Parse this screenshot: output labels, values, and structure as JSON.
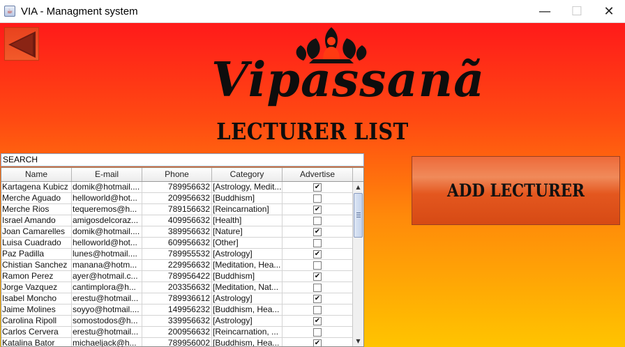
{
  "window": {
    "title": "VIA - Managment system",
    "minimize": "—",
    "maximize": "☐",
    "close": "✕"
  },
  "logo": {
    "text": "Vipassanã"
  },
  "page": {
    "title": "LECTURER LIST"
  },
  "search": {
    "value": "SEARCH"
  },
  "table": {
    "headers": [
      "Name",
      "E-mail",
      "Phone",
      "Category",
      "Advertise"
    ],
    "rows": [
      {
        "name": "Kartagena Kubicz",
        "email": "domik@hotmail....",
        "phone": "789956632",
        "category": "[Astrology, Medit...",
        "advertise": true
      },
      {
        "name": "Merche Aguado",
        "email": "helloworld@hot...",
        "phone": "209956632",
        "category": "[Buddhism]",
        "advertise": false
      },
      {
        "name": "Merche Rios",
        "email": "tequeremos@h...",
        "phone": "789156632",
        "category": "[Reincarnation]",
        "advertise": true
      },
      {
        "name": "Israel Amando",
        "email": "amigosdelcoraz...",
        "phone": "409956632",
        "category": "[Health]",
        "advertise": false
      },
      {
        "name": "Joan Camarelles",
        "email": "domik@hotmail....",
        "phone": "389956632",
        "category": "[Nature]",
        "advertise": true
      },
      {
        "name": "Luisa Cuadrado",
        "email": "helloworld@hot...",
        "phone": "609956632",
        "category": "[Other]",
        "advertise": false
      },
      {
        "name": "Paz Padilla",
        "email": "lunes@hotmail....",
        "phone": "789955532",
        "category": "[Astrology]",
        "advertise": true
      },
      {
        "name": "Chistian Sanchez",
        "email": "manana@hotm...",
        "phone": "229956632",
        "category": "[Meditation, Hea...",
        "advertise": false
      },
      {
        "name": "Ramon Perez",
        "email": "ayer@hotmail.c...",
        "phone": "789956422",
        "category": "[Buddhism]",
        "advertise": true
      },
      {
        "name": "Jorge Vazquez",
        "email": "cantimplora@h...",
        "phone": "203356632",
        "category": "[Meditation, Nat...",
        "advertise": false
      },
      {
        "name": "Isabel Moncho",
        "email": "erestu@hotmail...",
        "phone": "789936612",
        "category": "[Astrology]",
        "advertise": true
      },
      {
        "name": "Jaime Molines",
        "email": "soyyo@hotmail....",
        "phone": "149956232",
        "category": "[Buddhism, Hea...",
        "advertise": false
      },
      {
        "name": "Carolina Ripoll",
        "email": "somostodos@h...",
        "phone": "339956632",
        "category": "[Astrology]",
        "advertise": true
      },
      {
        "name": "Carlos Cervera",
        "email": "erestu@hotmail...",
        "phone": "200956632",
        "category": "[Reincarnation, ...",
        "advertise": false
      },
      {
        "name": "Katalina Bator",
        "email": "michaeljack@h...",
        "phone": "789956002",
        "category": "[Buddhism, Hea...",
        "advertise": true
      }
    ]
  },
  "add_button": {
    "label": "ADD LECTURER"
  },
  "icons": {
    "app": "java-icon",
    "back": "back-arrow-icon",
    "logo": "meditating-buddha-icon",
    "checked_glyph": "✔"
  },
  "colors": {
    "bg_top": "#ff1a1a",
    "bg_bottom": "#ffc400",
    "button": "#e4571f"
  }
}
